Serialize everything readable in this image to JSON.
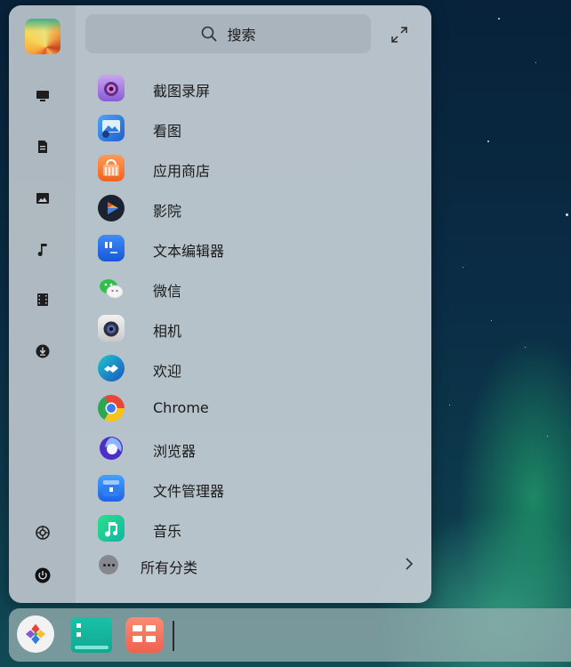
{
  "search": {
    "placeholder": "搜索"
  },
  "sidebar": {
    "items": [
      {
        "name": "computer-icon"
      },
      {
        "name": "document-icon"
      },
      {
        "name": "picture-icon"
      },
      {
        "name": "music-icon"
      },
      {
        "name": "video-icon"
      },
      {
        "name": "download-icon"
      }
    ],
    "bottom": [
      {
        "name": "settings-icon"
      },
      {
        "name": "power-icon"
      }
    ]
  },
  "apps": [
    {
      "label": "截图录屏",
      "icon": "screenshot-icon"
    },
    {
      "label": "看图",
      "icon": "image-viewer-icon"
    },
    {
      "label": "应用商店",
      "icon": "app-store-icon"
    },
    {
      "label": "影院",
      "icon": "movie-icon"
    },
    {
      "label": "文本编辑器",
      "icon": "text-editor-icon"
    },
    {
      "label": "微信",
      "icon": "wechat-icon"
    },
    {
      "label": "相机",
      "icon": "camera-icon"
    },
    {
      "label": "欢迎",
      "icon": "welcome-icon"
    },
    {
      "label": "Chrome",
      "icon": "chrome-icon"
    },
    {
      "label": "浏览器",
      "icon": "browser-icon"
    },
    {
      "label": "文件管理器",
      "icon": "file-manager-icon"
    },
    {
      "label": "音乐",
      "icon": "music-app-icon"
    }
  ],
  "all_categories": {
    "label": "所有分类"
  },
  "dock": {
    "items": [
      {
        "name": "launcher-icon"
      },
      {
        "name": "terminal-icon"
      },
      {
        "name": "app-store-icon"
      }
    ]
  }
}
